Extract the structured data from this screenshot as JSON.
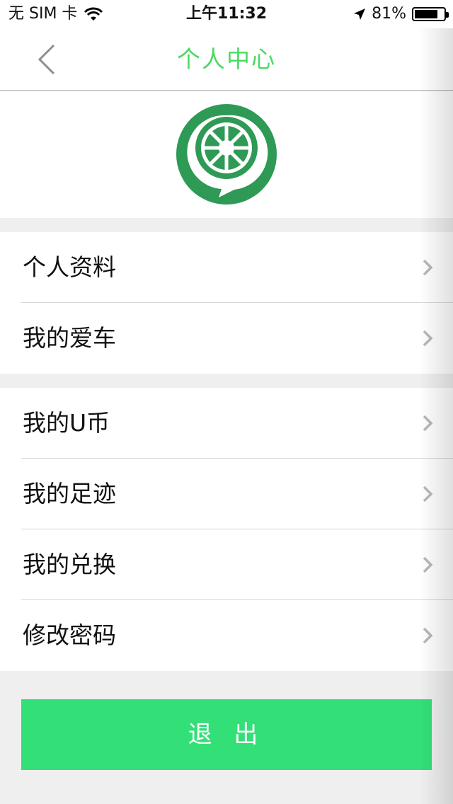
{
  "status_bar": {
    "carrier": "无 SIM 卡",
    "time": "上午11:32",
    "battery_percent": "81%",
    "battery_level": 0.81,
    "icons": [
      "wifi-icon",
      "location-arrow-icon",
      "battery-icon"
    ]
  },
  "nav": {
    "title": "个人中心",
    "back_icon": "chevron-left-icon",
    "title_color": "#4cd964"
  },
  "logo": {
    "icon": "wheel-logo-icon",
    "color": "#2e9a55"
  },
  "menu": {
    "group1": [
      {
        "label": "个人资料"
      },
      {
        "label": "我的爱车"
      }
    ],
    "group2": [
      {
        "label": "我的U币"
      },
      {
        "label": "我的足迹"
      },
      {
        "label": "我的兑换"
      },
      {
        "label": "修改密码"
      }
    ],
    "row_icon": "chevron-right-icon"
  },
  "logout": {
    "label": "退 出",
    "color": "#33df77"
  }
}
